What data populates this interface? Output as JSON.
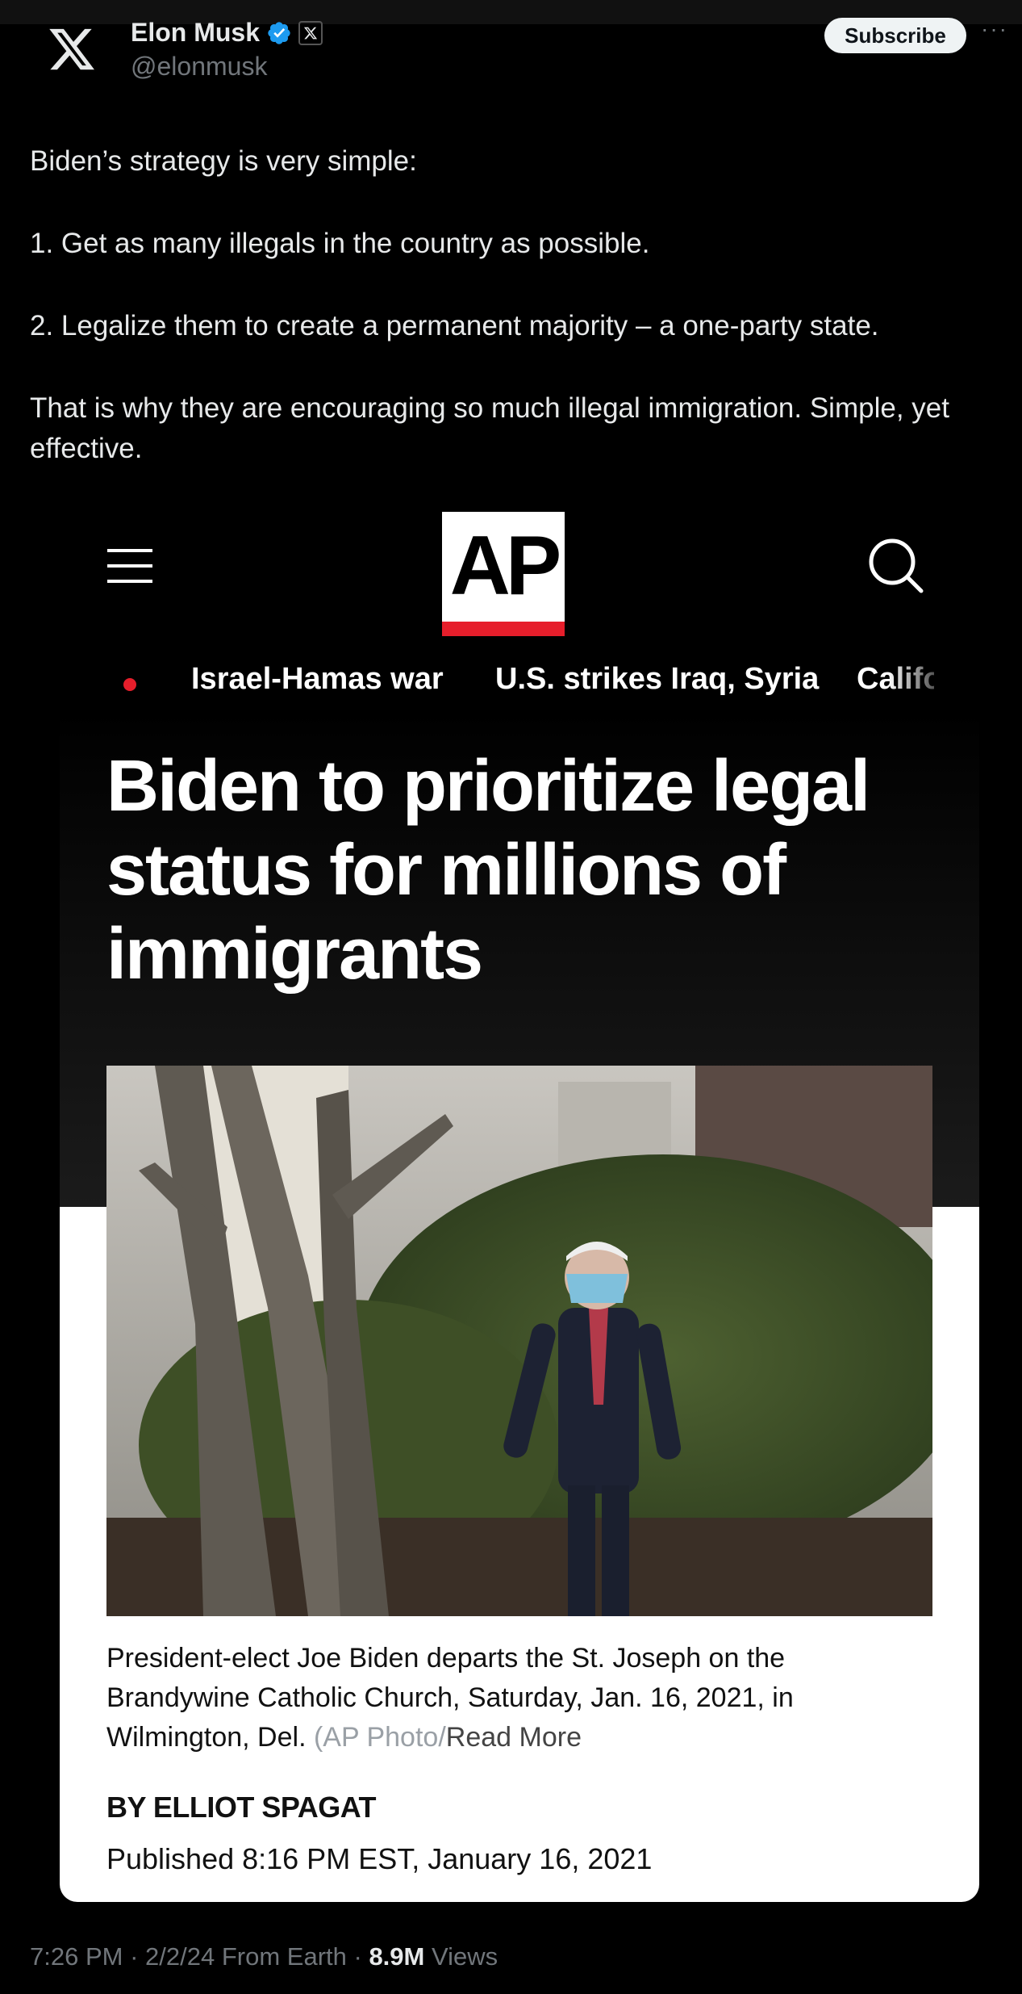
{
  "author": {
    "name": "Elon Musk",
    "handle": "@elonmusk",
    "subscribe_label": "Subscribe",
    "more_label": "···"
  },
  "tweet": {
    "lines": [
      "Biden’s strategy is very simple:",
      "1. Get as many illegals in the country as possible.",
      "2. Legalize them to create a permanent majority – a one-party state.",
      "That is why they are encouraging so much illegal immigration. Simple, yet effective."
    ]
  },
  "ap_card": {
    "logo_text": "AP",
    "trending": [
      "Israel-Hamas war",
      "U.S. strikes Iraq, Syria",
      "Califo"
    ],
    "headline": "Biden to prioritize legal status for millions of immigrants",
    "caption_main": "President-elect Joe Biden departs the St. Joseph on the Brandywine Catholic Church, Saturday, Jan. 16, 2021, in Wilmington, Del.",
    "caption_fade": " (AP Photo/",
    "read_more": "Read More",
    "byline": "BY ELLIOT SPAGAT",
    "published": "Published 8:16 PM EST, January 16, 2021"
  },
  "footer": {
    "time": "7:26 PM",
    "date": "2/2/24",
    "source": "From Earth",
    "views_count": "8.9M",
    "views_label": "Views"
  },
  "colors": {
    "ap_red": "#e61e2b",
    "verified_blue": "#1d9bf0",
    "muted": "#71767b"
  },
  "icons": [
    "x-logo-icon",
    "verified-badge-icon",
    "x-affiliate-icon",
    "menu-icon",
    "search-icon",
    "more-icon"
  ]
}
